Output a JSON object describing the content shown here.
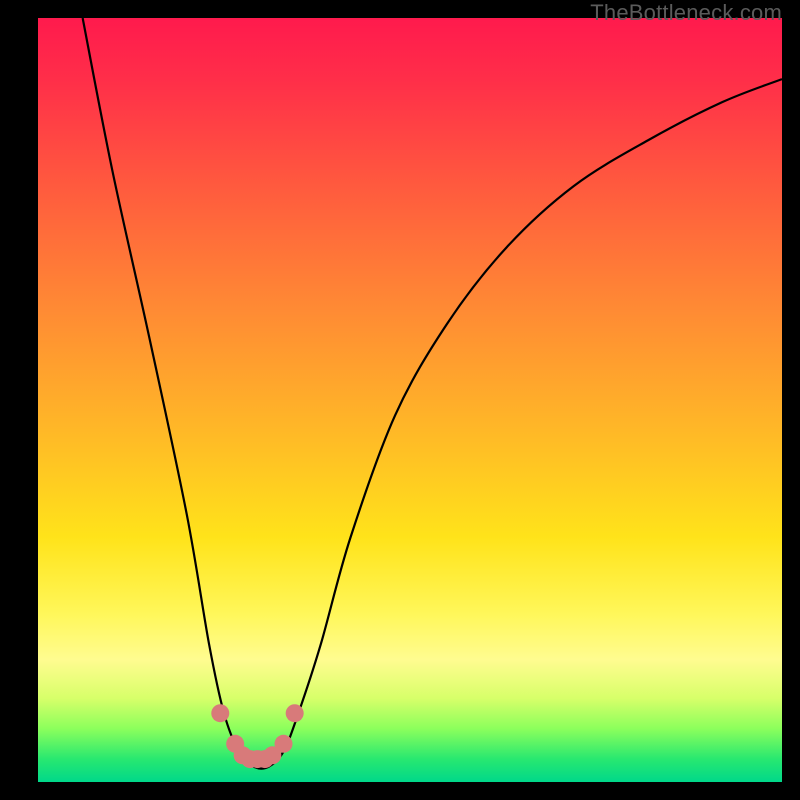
{
  "watermark": "TheBottleneck.com",
  "chart_data": {
    "type": "line",
    "title": "",
    "xlabel": "",
    "ylabel": "",
    "xlim": [
      0,
      100
    ],
    "ylim": [
      0,
      100
    ],
    "series": [
      {
        "name": "bottleneck-curve",
        "x": [
          6,
          10,
          15,
          20,
          23,
          25,
          27,
          29,
          31,
          33,
          35,
          38,
          42,
          48,
          55,
          63,
          72,
          82,
          92,
          100
        ],
        "y": [
          100,
          80,
          58,
          35,
          18,
          9,
          4,
          2,
          2,
          4,
          9,
          18,
          32,
          48,
          60,
          70,
          78,
          84,
          89,
          92
        ]
      }
    ],
    "markers": {
      "name": "highlight-dots",
      "x": [
        24.5,
        26.5,
        27.5,
        28.5,
        29.5,
        30.5,
        31.5,
        33.0,
        34.5
      ],
      "y": [
        9,
        5,
        3.5,
        3,
        3,
        3,
        3.5,
        5,
        9
      ]
    },
    "background_gradient": [
      "#ff1a4d",
      "#ffb827",
      "#fff75a",
      "#00d88a"
    ]
  }
}
